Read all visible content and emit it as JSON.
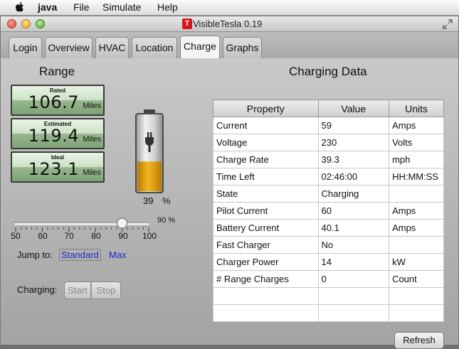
{
  "menubar": {
    "app": "java",
    "items": [
      "File",
      "Simulate",
      "Help"
    ]
  },
  "window": {
    "title": "VisibleTesla 0.19",
    "logo_letter": "T"
  },
  "tabs": [
    "Login",
    "Overview",
    "HVAC",
    "Location",
    "Charge",
    "Graphs"
  ],
  "active_tab": "Charge",
  "range": {
    "heading": "Range",
    "meters": [
      {
        "label": "Rated",
        "value": "106.7",
        "unit": "Miles"
      },
      {
        "label": "Estimated",
        "value": "119.4",
        "unit": "Miles"
      },
      {
        "label": "Ideal",
        "value": "123.1",
        "unit": "Miles"
      }
    ]
  },
  "battery": {
    "level": 0.39,
    "percent_value": "39",
    "percent_unit": "%",
    "fill_color": "#e3a10b"
  },
  "slider": {
    "value": 90,
    "value_label": "90 %",
    "ticks": [
      "50",
      "60",
      "70",
      "80",
      "90",
      "100"
    ]
  },
  "jump": {
    "label": "Jump to:",
    "standard": "Standard",
    "max": "Max"
  },
  "charging": {
    "label": "Charging:",
    "start": "Start",
    "stop": "Stop"
  },
  "charging_data": {
    "heading": "Charging Data",
    "columns": [
      "Property",
      "Value",
      "Units"
    ],
    "rows": [
      [
        "Current",
        "59",
        "Amps"
      ],
      [
        "Voltage",
        "230",
        "Volts"
      ],
      [
        "Charge Rate",
        "39.3",
        "mph"
      ],
      [
        "Time Left",
        "02:46:00",
        "HH:MM:SS"
      ],
      [
        "State",
        "Charging",
        ""
      ],
      [
        "Pilot Current",
        "60",
        "Amps"
      ],
      [
        "Battery Current",
        "40.1",
        "Amps"
      ],
      [
        "Fast Charger",
        "No",
        ""
      ],
      [
        "Charger Power",
        "14",
        "kW"
      ],
      [
        "# Range Charges",
        "0",
        "Count"
      ],
      [
        "",
        "",
        ""
      ],
      [
        "",
        "",
        ""
      ]
    ]
  },
  "refresh_label": "Refresh"
}
